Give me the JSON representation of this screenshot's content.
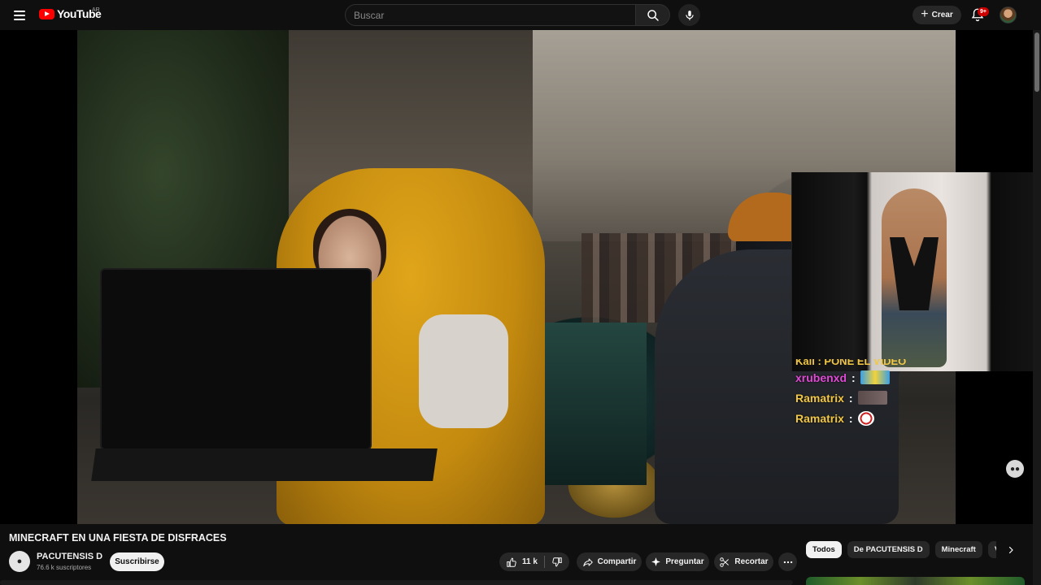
{
  "header": {
    "logo_text": "YouTube",
    "region": "AR",
    "search_placeholder": "Buscar",
    "create_label": "Crear",
    "notifications_badge": "9+"
  },
  "video": {
    "title": "MINECRAFT EN UNA FIESTA DE DISFRACES",
    "chat": [
      {
        "user": "xrubenxd",
        "sep": ":",
        "style": "pink"
      },
      {
        "user": "Ramatrix",
        "sep": ":",
        "style": "yellow"
      },
      {
        "user": "Ramatrix",
        "sep": ":",
        "style": "yellow"
      }
    ],
    "chat_cut_text": "Kali : PONE EL VIDEO"
  },
  "channel": {
    "name": "PACUTENSIS D",
    "subscribers": "76.6 k suscriptores",
    "subscribe_label": "Suscribirse"
  },
  "actions": {
    "likes": "11 k",
    "share_label": "Compartir",
    "ask_label": "Preguntar",
    "clip_label": "Recortar"
  },
  "chips": [
    "Todos",
    "De PACUTENSIS D",
    "Minecraft",
    "Videos relacionados"
  ],
  "colors": {
    "brand": "#ff0000",
    "background": "#0f0f0f",
    "chat_name_yellow": "#f2c744",
    "chat_name_pink": "#e04ad6"
  }
}
